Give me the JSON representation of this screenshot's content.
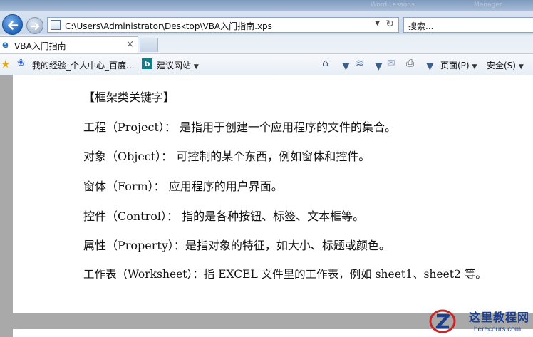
{
  "browser": {
    "top_strip_blurred": [
      "Word Lessons",
      "Manager"
    ],
    "address": "C:\\Users\\Administrator\\Desktop\\VBA入门指南.xps",
    "search_placeholder": "搜索...",
    "tab_title": "VBA入门指南",
    "tab_close": "×",
    "favorites": {
      "item1": "我的经验_个人中心_百度...",
      "item2": "建议网站"
    },
    "menus": {
      "page": "页面(P)",
      "safety": "安全(S)"
    }
  },
  "document": {
    "lines": [
      "【框架类关键字】",
      "工程（Project）：  是指用于创建一个应用程序的文件的集合。",
      "对象（Object）：  可控制的某个东西，例如窗体和控件。",
      "窗体（Form）：  应用程序的用户界面。",
      "控件（Control）：  指的是各种按钮、标签、文本框等。",
      "属性（Property）：是指对象的特征，如大小、标题或颜色。",
      "工作表（Worksheet）：指 EXCEL 文件里的工作表，例如 sheet1、sheet2 等。"
    ]
  },
  "watermark": {
    "name": "这里教程网",
    "url": "herecours.com"
  },
  "colors": {
    "chrome_blue": "#c9d8ea",
    "back_button": "#1f63b9",
    "gray_background": "#a9a9a9",
    "watermark_blue": "#1d3f8e"
  }
}
